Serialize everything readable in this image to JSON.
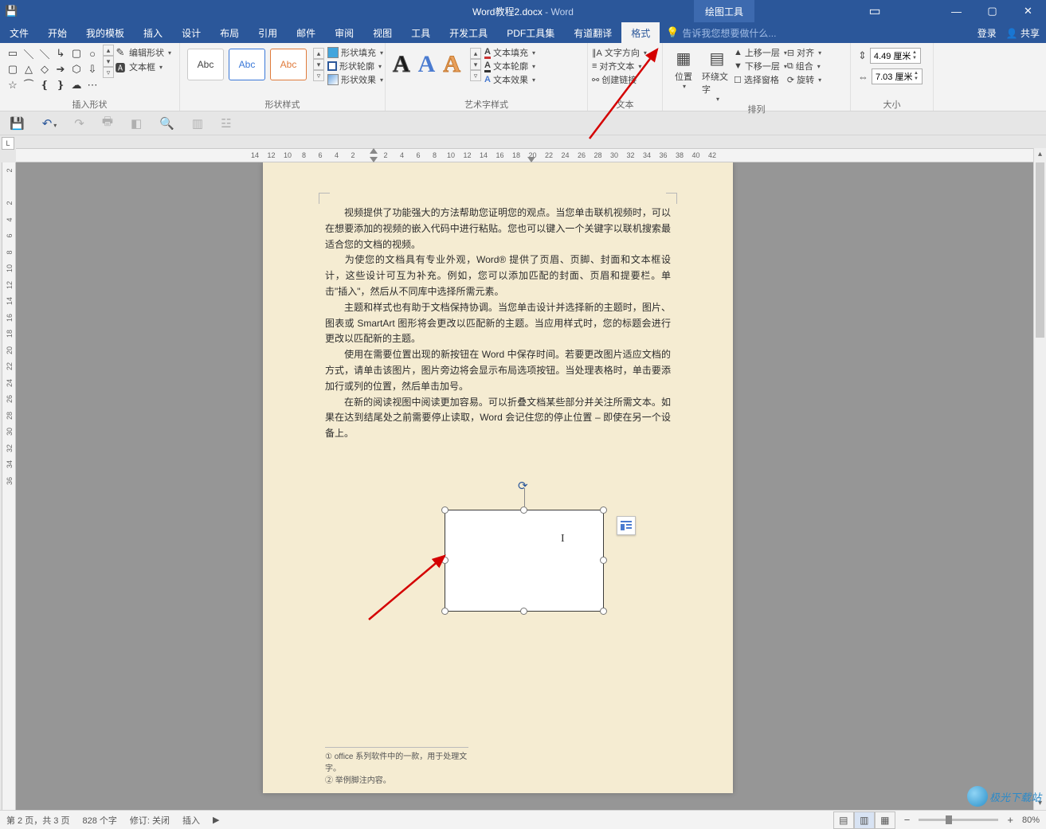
{
  "title": {
    "doc": "Word教程2.docx",
    "app": "Word"
  },
  "context_tab": "绘图工具",
  "menus": [
    "文件",
    "开始",
    "我的模板",
    "插入",
    "设计",
    "布局",
    "引用",
    "邮件",
    "审阅",
    "视图",
    "工具",
    "开发工具",
    "PDF工具集",
    "有道翻译",
    "格式"
  ],
  "active_menu": "格式",
  "tell_me_placeholder": "告诉我您想要做什么...",
  "login": "登录",
  "share": "共享",
  "ribbon": {
    "insert_shapes_label": "插入形状",
    "edit_shape": "编辑形状",
    "text_box": "文本框",
    "shape_styles_label": "形状样式",
    "style_text": "Abc",
    "shape_fill": "形状填充",
    "shape_outline": "形状轮廓",
    "shape_effects": "形状效果",
    "wordart_label": "艺术字样式",
    "text_fill": "文本填充",
    "text_outline": "文本轮廓",
    "text_effects": "文本效果",
    "text_group_label": "文本",
    "text_direction": "文字方向",
    "align_text": "对齐文本",
    "create_link": "创建链接",
    "arrange_label": "排列",
    "position": "位置",
    "wrap_text": "环绕文字",
    "bring_forward": "上移一层",
    "send_backward": "下移一层",
    "selection_pane": "选择窗格",
    "align": "对齐",
    "group": "组合",
    "rotate": "旋转",
    "size_label": "大小",
    "height": "4.49 厘米",
    "width": "7.03 厘米"
  },
  "hruler_ticks": [
    "14",
    "12",
    "10",
    "8",
    "6",
    "4",
    "2",
    "",
    "2",
    "4",
    "6",
    "8",
    "10",
    "12",
    "14",
    "16",
    "18",
    "20",
    "22",
    "24",
    "26",
    "28",
    "30",
    "32",
    "34",
    "36",
    "38",
    "40",
    "42"
  ],
  "vruler_ticks": [
    "2",
    "",
    "2",
    "4",
    "6",
    "8",
    "10",
    "12",
    "14",
    "16",
    "18",
    "20",
    "22",
    "24",
    "26",
    "28",
    "30",
    "32",
    "34",
    "36"
  ],
  "document": {
    "p1": "视频提供了功能强大的方法帮助您证明您的观点。当您单击联机视频时，可以在想要添加的视频的嵌入代码中进行粘贴。您也可以键入一个关键字以联机搜索最适合您的文档的视频。",
    "p2": "为使您的文档具有专业外观，Word® 提供了页眉、页脚、封面和文本框设计，这些设计可互为补充。例如，您可以添加匹配的封面、页眉和提要栏。单击\"插入\"，然后从不同库中选择所需元素。",
    "p3": "主题和样式也有助于文档保持协调。当您单击设计并选择新的主题时，图片、图表或 SmartArt 图形将会更改以匹配新的主题。当应用样式时，您的标题会进行更改以匹配新的主题。",
    "p4": "使用在需要位置出现的新按钮在 Word 中保存时间。若要更改图片适应文档的方式，请单击该图片，图片旁边将会显示布局选项按钮。当处理表格时，单击要添加行或列的位置，然后单击加号。",
    "p5": "在新的阅读视图中阅读更加容易。可以折叠文档某些部分并关注所需文本。如果在达到结尾处之前需要停止读取，Word 会记住您的停止位置 – 即使在另一个设备上。",
    "foot1": "office 系列软件中的一款，用于处理文字。",
    "foot2": "举例脚注内容。"
  },
  "status": {
    "page": "第 2 页，共 3 页",
    "words": "828 个字",
    "track": "修订: 关闭",
    "mode": "插入",
    "zoom": "80%"
  },
  "watermark": "极光下载站"
}
